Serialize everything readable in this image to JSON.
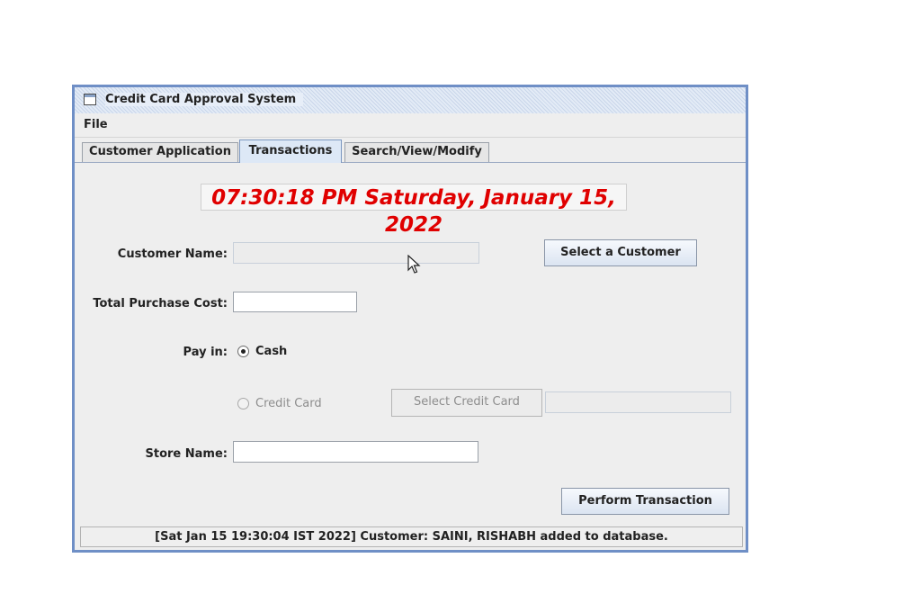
{
  "window": {
    "title": "Credit Card Approval  System"
  },
  "menubar": {
    "file": "File"
  },
  "tabs": [
    {
      "label": "Customer Application",
      "active": false
    },
    {
      "label": "Transactions",
      "active": true
    },
    {
      "label": "Search/View/Modify",
      "active": false
    }
  ],
  "clock": {
    "text": "07:30:18 PM  Saturday, January 15, 2022",
    "color": "#e00000"
  },
  "form": {
    "customer_name_label": "Customer Name:",
    "customer_name_value": "",
    "select_customer_button": "Select a Customer",
    "total_purchase_cost_label": "Total Purchase Cost:",
    "total_purchase_cost_value": "",
    "pay_in_label": "Pay in:",
    "pay_cash_label": "Cash",
    "pay_cash_selected": true,
    "pay_credit_label": "Credit Card",
    "pay_credit_selected": false,
    "select_credit_card_button": "Select Credit Card",
    "credit_card_value": "",
    "store_name_label": "Store Name:",
    "store_name_value": "",
    "perform_transaction_button": "Perform Transaction"
  },
  "status": {
    "message": "[Sat Jan 15 19:30:04 IST 2022] Customer: SAINI, RISHABH added to database."
  },
  "icons": {
    "window_icon": "window-icon",
    "cursor": "mouse-pointer-icon"
  }
}
